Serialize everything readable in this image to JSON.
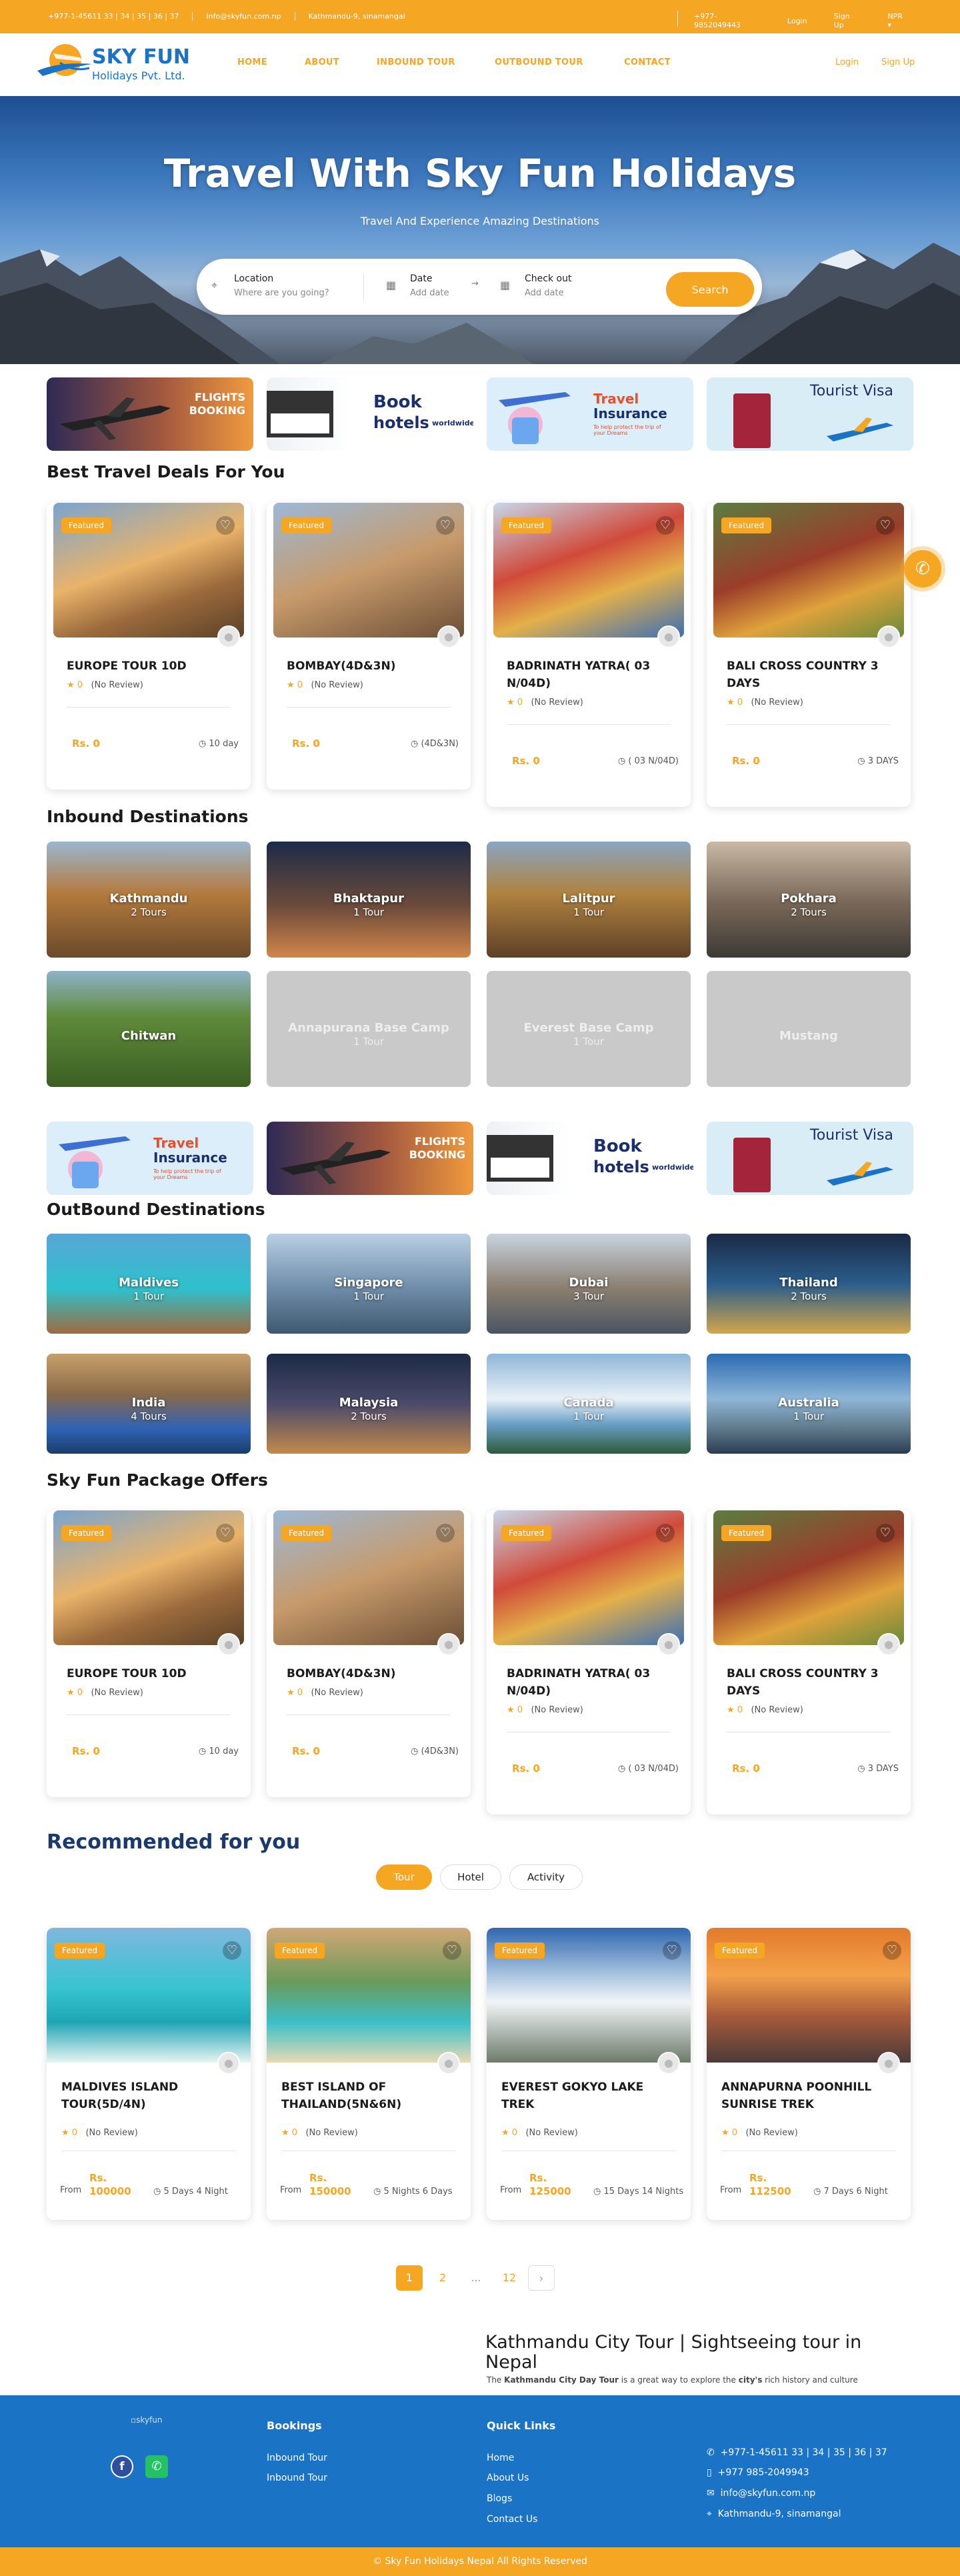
{
  "topbar": {
    "phone": "+977-1-45611 33 | 34 | 35 | 36 | 37",
    "email": "info@skyfun.com.np",
    "address": "Kathmandu-9, sinamangal",
    "mobile": "+977-9852049443",
    "login": "Login",
    "signup": "Sign Up",
    "currency": "NPR"
  },
  "logo": {
    "name": "SKY FUN",
    "sub": "Holidays Pvt. Ltd."
  },
  "nav": {
    "items": [
      "HOME",
      "ABOUT",
      "INBOUND TOUR",
      "OUTBOUND TOUR",
      "CONTACT"
    ],
    "login": "Login",
    "signup": "Sign Up"
  },
  "hero": {
    "title": "Travel With Sky Fun Holidays",
    "subtitle": "Travel And Experience Amazing Destinations"
  },
  "search": {
    "location_label": "Location",
    "location_placeholder": "Where are you going?",
    "date_label": "Date",
    "date_placeholder": "Add date",
    "checkout_label": "Check out",
    "checkout_placeholder": "Add date",
    "button": "Search"
  },
  "banners": {
    "flights": {
      "line1": "FLIGHTS",
      "line2": "BOOKING"
    },
    "hotels": {
      "line1": "Book",
      "line2": "hotels",
      "line3": "worldwide"
    },
    "insurance": {
      "line1": "Travel",
      "line2": "Insurance",
      "line3": "To help protect the trip of your Dreams"
    },
    "visa": {
      "line1": "Tourist Visa"
    }
  },
  "sections": {
    "deals": "Best Travel Deals For You",
    "inbound": "Inbound Destinations",
    "outbound": "OutBound Destinations",
    "packages": "Sky Fun Package Offers",
    "recommended": "Recommended for you"
  },
  "deals": [
    {
      "badge": "Featured",
      "title": "EUROPE TOUR 10D",
      "rating": "0",
      "reviews": "(No Review)",
      "price": "Rs. 0",
      "duration": "10 day"
    },
    {
      "badge": "Featured",
      "title": "BOMBAY(4D&3N)",
      "rating": "0",
      "reviews": "(No Review)",
      "price": "Rs. 0",
      "duration": "(4D&3N)"
    },
    {
      "badge": "Featured",
      "title": "BADRINATH YATRA( 03 N/04D)",
      "rating": "0",
      "reviews": "(No Review)",
      "price": "Rs. 0",
      "duration": "( 03 N/04D)"
    },
    {
      "badge": "Featured",
      "title": "BALI CROSS COUNTRY 3 DAYS",
      "rating": "0",
      "reviews": "(No Review)",
      "price": "Rs. 0",
      "duration": "3 DAYS"
    }
  ],
  "inbound": [
    {
      "name": "Kathmandu",
      "tours": "2 Tours"
    },
    {
      "name": "Bhaktapur",
      "tours": "1 Tour"
    },
    {
      "name": "Lalitpur",
      "tours": "1 Tour"
    },
    {
      "name": "Pokhara",
      "tours": "2 Tours"
    },
    {
      "name": "Chitwan",
      "tours": ""
    },
    {
      "name": "Annapurana Base Camp",
      "tours": "1 Tour"
    },
    {
      "name": "Everest Base Camp",
      "tours": "1 Tour"
    },
    {
      "name": "Mustang",
      "tours": ""
    }
  ],
  "outbound": [
    {
      "name": "Maldives",
      "tours": "1 Tour"
    },
    {
      "name": "Singapore",
      "tours": "1 Tour"
    },
    {
      "name": "Dubai",
      "tours": "3 Tour"
    },
    {
      "name": "Thailand",
      "tours": "2 Tours"
    },
    {
      "name": "India",
      "tours": "4 Tours"
    },
    {
      "name": "Malaysia",
      "tours": "2 Tours"
    },
    {
      "name": "Canada",
      "tours": "1 Tour"
    },
    {
      "name": "Australia",
      "tours": "1 Tour"
    }
  ],
  "packages": [
    {
      "badge": "Featured",
      "title": "EUROPE TOUR 10D",
      "rating": "0",
      "reviews": "(No Review)",
      "price": "Rs. 0",
      "duration": "10 day"
    },
    {
      "badge": "Featured",
      "title": "BOMBAY(4D&3N)",
      "rating": "0",
      "reviews": "(No Review)",
      "price": "Rs. 0",
      "duration": "(4D&3N)"
    },
    {
      "badge": "Featured",
      "title": "BADRINATH YATRA( 03 N/04D)",
      "rating": "0",
      "reviews": "(No Review)",
      "price": "Rs. 0",
      "duration": "( 03 N/04D)"
    },
    {
      "badge": "Featured",
      "title": "BALI CROSS COUNTRY 3 DAYS",
      "rating": "0",
      "reviews": "(No Review)",
      "price": "Rs. 0",
      "duration": "3 DAYS"
    }
  ],
  "tabs": [
    "Tour",
    "Hotel",
    "Activity"
  ],
  "recommended": [
    {
      "badge": "Featured",
      "title": "MALDIVES ISLAND TOUR(5D/4N)",
      "rating": "0",
      "reviews": "(No Review)",
      "from": "From",
      "price1": "Rs.",
      "price2": "100000",
      "duration": "5 Days 4 Night"
    },
    {
      "badge": "Featured",
      "title": "BEST ISLAND OF THAILAND(5N&6N)",
      "rating": "0",
      "reviews": "(No Review)",
      "from": "From",
      "price1": "Rs.",
      "price2": "150000",
      "duration": "5 Nights 6 Days"
    },
    {
      "badge": "Featured",
      "title": "EVEREST GOKYO LAKE TREK",
      "rating": "0",
      "reviews": "(No Review)",
      "from": "From",
      "price1": "Rs.",
      "price2": "125000",
      "duration": "15 Days 14 Nights"
    },
    {
      "badge": "Featured",
      "title": "ANNAPURNA POONHILL SUNRISE TREK",
      "rating": "0",
      "reviews": "(No Review)",
      "from": "From",
      "price1": "Rs.",
      "price2": "112500",
      "duration": "7 Days 6 Night"
    }
  ],
  "pagination": {
    "current": "1",
    "next": "2",
    "dots": "...",
    "last": "12",
    "arrow": "›"
  },
  "feature": {
    "title": "Kathmandu City Tour | Sightseeing tour in Nepal",
    "desc_pre": "The ",
    "desc_b1": "Kathmandu City Day Tour",
    "desc_mid": " is a great way to explore the ",
    "desc_b2": "city's",
    "desc_post": " rich history and culture"
  },
  "footer": {
    "logo_alt": "skyfun",
    "bookings_title": "Bookings",
    "bookings": [
      "Inbound Tour",
      "Inbound Tour"
    ],
    "quick_title": "Quick Links",
    "quick": [
      "Home",
      "About Us",
      "Blogs",
      "Contact Us"
    ],
    "contact": {
      "phone": "+977-1-45611 33 | 34 | 35 | 36 | 37",
      "mobile": "+977 985-2049943",
      "email": "info@skyfun.com.np",
      "address": "Kathmandu-9, sinamangal"
    }
  },
  "copyright": "© Sky Fun Holidays Nepal All Rights Reserved"
}
